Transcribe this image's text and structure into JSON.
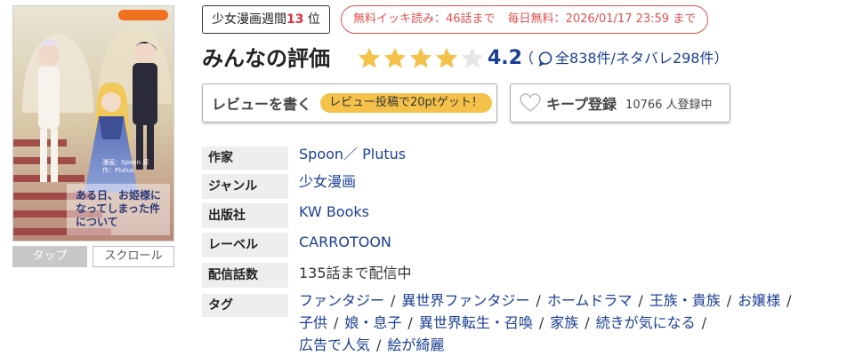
{
  "cover": {
    "label_icon": "carrot-logo",
    "title_text": "ある日、お姫様になってしまった件について",
    "credit_text": "漫画：Spoon 原作：Plutus"
  },
  "view_buttons": {
    "tap": "タップ",
    "scroll": "スクロール"
  },
  "rank": {
    "prefix": "少女漫画週間",
    "number": "13",
    "suffix": " 位"
  },
  "promo": {
    "free_read": "無料イッキ読み：46話まで",
    "daily_free": "毎日無料：2026/01/17 23:59 まで"
  },
  "rating": {
    "title": "みんなの評価",
    "score": "4.2",
    "stars_filled": 4,
    "stars_total": 5,
    "count_open": "（",
    "count_text": "全838件/ネタバレ298件",
    "count_close": "）"
  },
  "review_button": {
    "label": "レビューを書く",
    "reward": "レビュー投稿で20ptゲット！"
  },
  "keep_button": {
    "label": "キープ登録",
    "count": "10766 人登録中"
  },
  "info": {
    "author_label": "作家",
    "author_value": "Spoon／ Plutus",
    "genre_label": "ジャンル",
    "genre_value": "少女漫画",
    "publisher_label": "出版社",
    "publisher_value": "KW Books",
    "label_label": "レーベル",
    "label_value": "CARROTOON",
    "episodes_label": "配信話数",
    "episodes_value": "135話まで配信中",
    "tags_label": "タグ",
    "tags": [
      "ファンタジー",
      "異世界ファンタジー",
      "ホームドラマ",
      "王族・貴族",
      "お嬢様",
      "子供",
      "娘・息子",
      "異世界転生・召喚",
      "家族",
      "続きが気になる",
      "広告で人気",
      "絵が綺麗"
    ]
  },
  "colors": {
    "link": "#1b3f95",
    "star": "#f4c24a",
    "promo": "#e05050",
    "rank": "#e0303a"
  }
}
